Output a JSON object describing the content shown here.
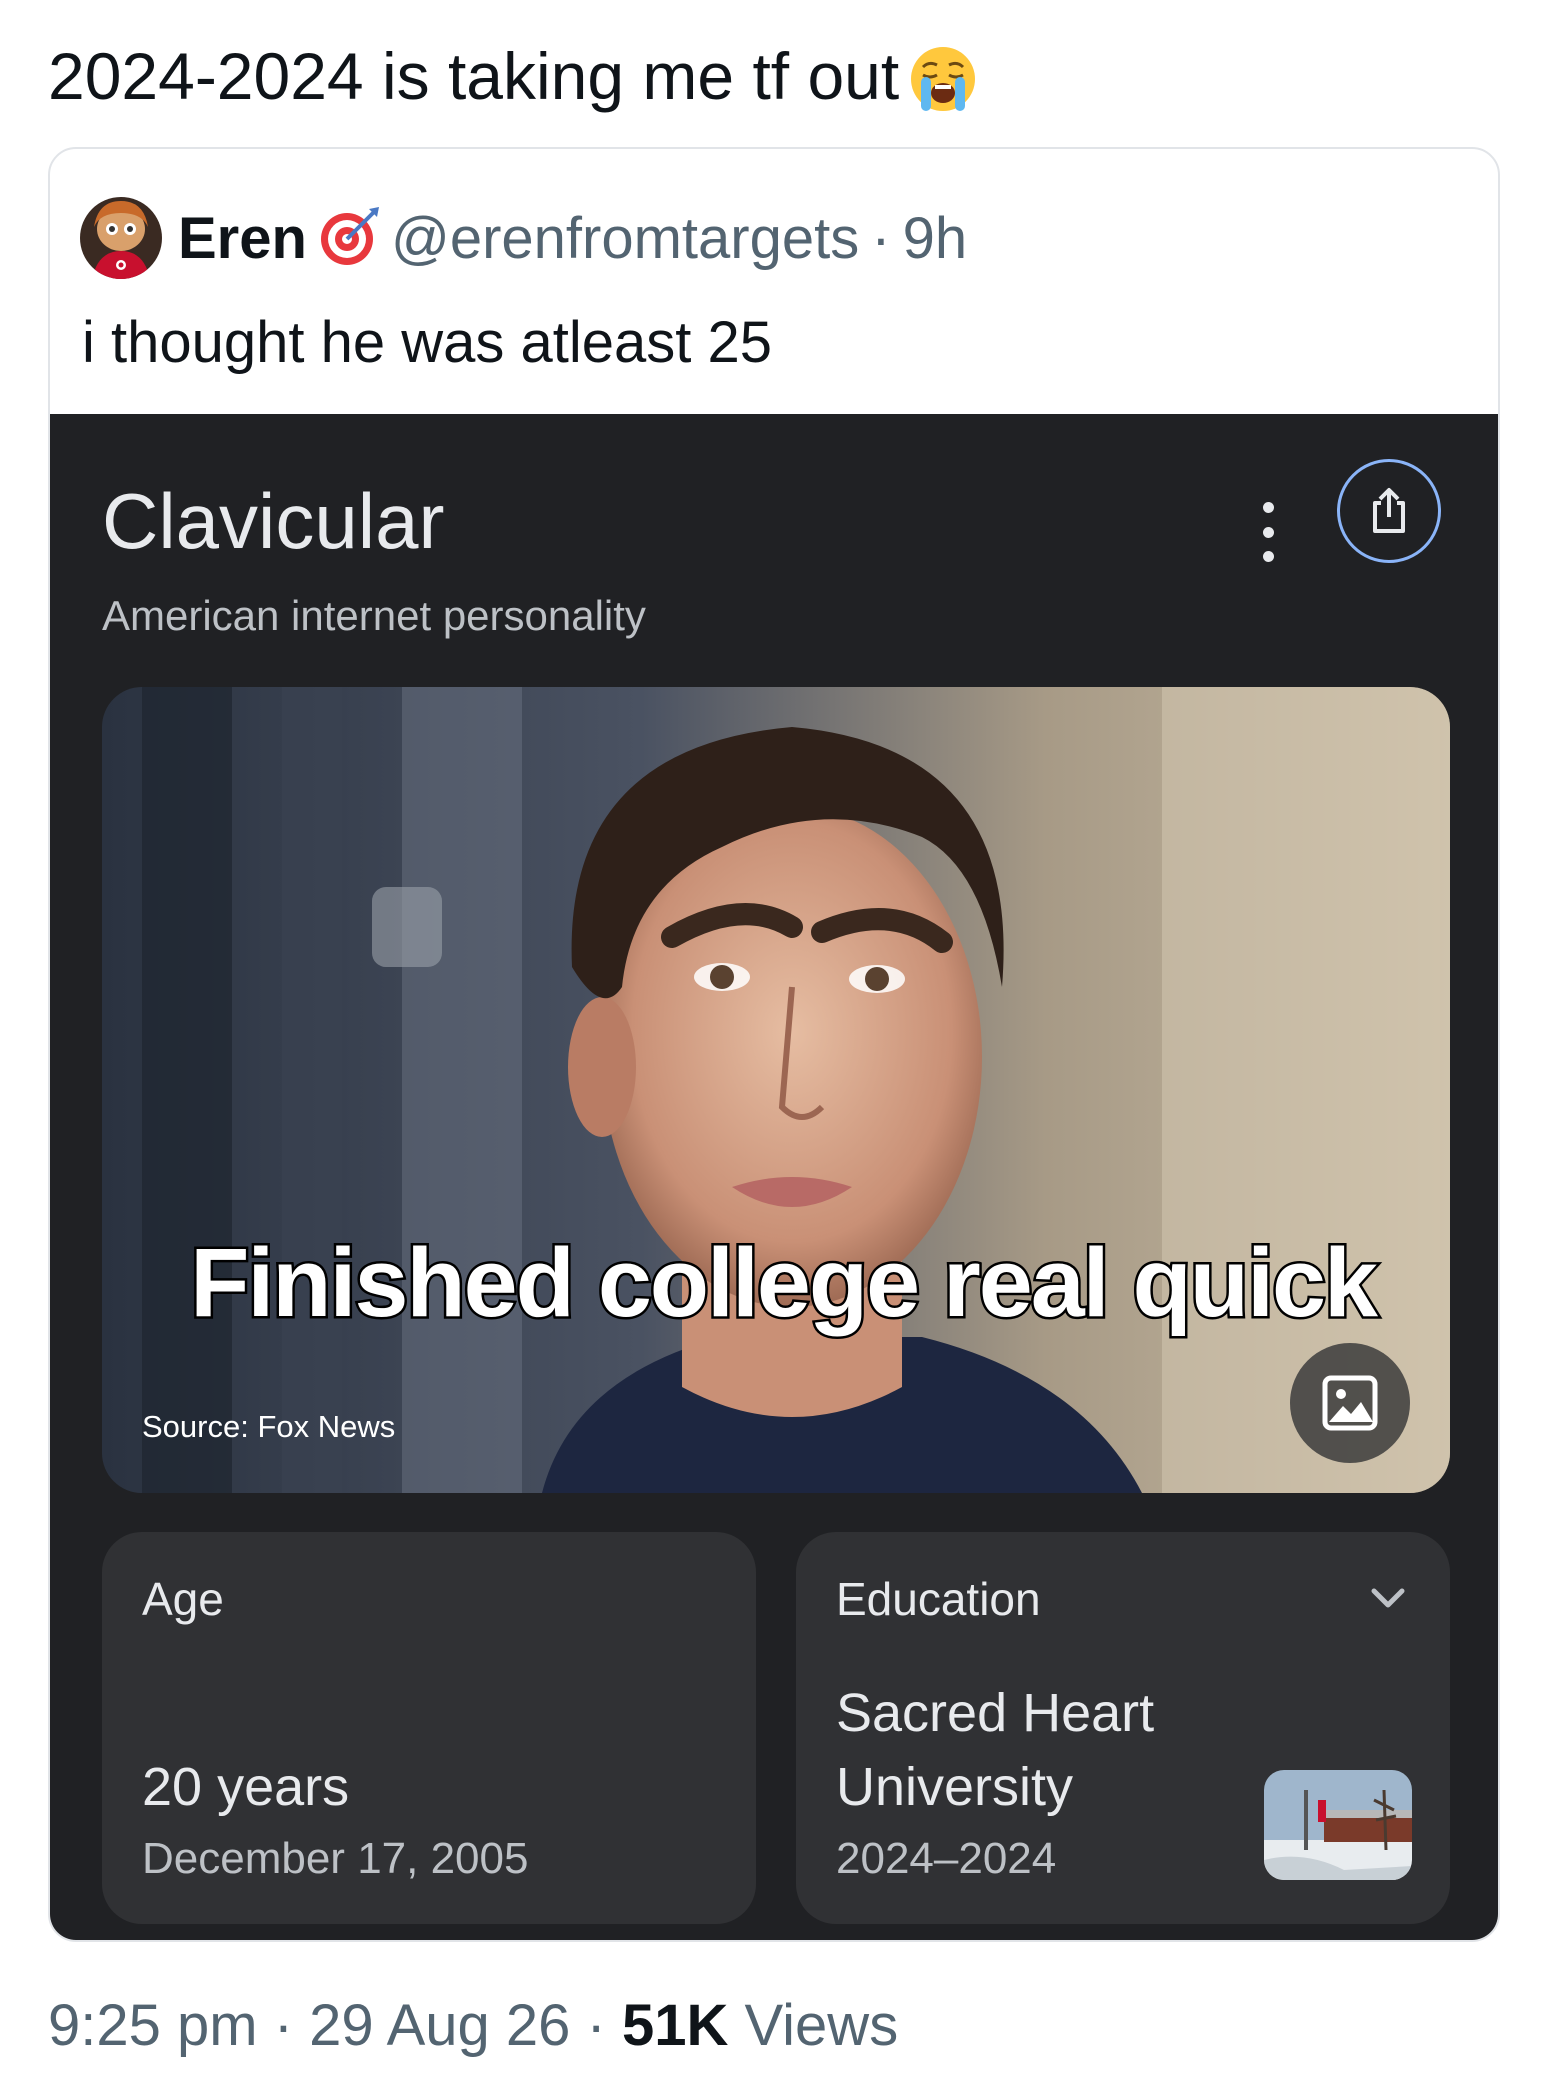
{
  "tweet": {
    "text": "2024-2024 is taking me tf out",
    "emoji_icon": "loudly-crying-face-emoji"
  },
  "quote": {
    "author_name": "Eren",
    "badge_icon": "target-dart-emoji",
    "handle": "@erenfromtargets",
    "separator": "·",
    "time_ago": "9h",
    "text": "i thought he was atleast 25"
  },
  "knowledge_panel": {
    "title": "Clavicular",
    "subtitle": "American internet personality",
    "more_icon": "more-vertical-icon",
    "share_icon": "share-icon",
    "photo": {
      "caption": "Finished college real quick",
      "source": "Source: Fox News",
      "image_icon": "image-icon"
    },
    "age": {
      "label": "Age",
      "value": "20 years",
      "sub": "December 17, 2005"
    },
    "education": {
      "label": "Education",
      "value_line1": "Sacred Heart",
      "value_line2": "University",
      "sub": "2024–2024",
      "chevron_icon": "chevron-down-icon"
    }
  },
  "meta": {
    "time": "9:25 pm",
    "dot1": "·",
    "date": "29 Aug 26",
    "dot2": "·",
    "views_count": "51K",
    "views_label": "Views"
  },
  "colors": {
    "panel_bg": "#202124",
    "card_bg": "#303134",
    "accent_blue": "#8ab4f8",
    "muted_text": "#536471"
  }
}
